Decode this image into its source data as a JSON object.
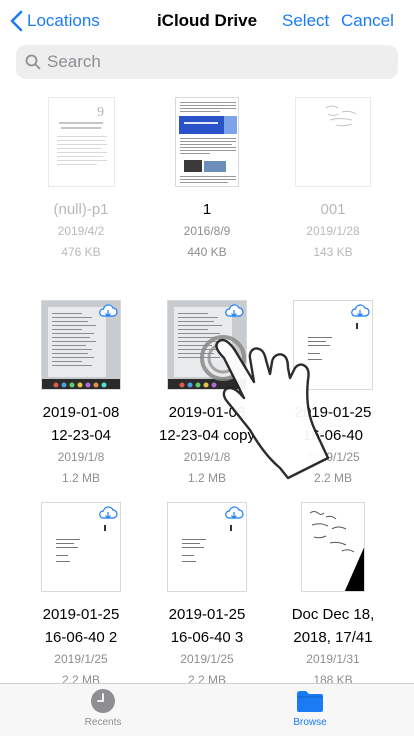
{
  "nav": {
    "back_label": "Locations",
    "title": "iCloud Drive",
    "select_label": "Select",
    "cancel_label": "Cancel"
  },
  "search": {
    "placeholder": "Search"
  },
  "files": [
    {
      "name": "(null)-p1",
      "date": "2019/4/2",
      "size": "476 KB",
      "dimmed": true
    },
    {
      "name": "1",
      "date": "2016/8/9",
      "size": "440 KB",
      "dimmed": false
    },
    {
      "name": "001",
      "date": "2019/1/28",
      "size": "143 KB",
      "dimmed": true
    },
    {
      "name": "2019-01-08\n12-23-04",
      "date": "2019/1/8",
      "size": "1.2 MB",
      "dimmed": false,
      "cloud": true
    },
    {
      "name": "2019-01-08\n12-23-04 copy",
      "date": "2019/1/8",
      "size": "1.2 MB",
      "dimmed": false,
      "cloud": true
    },
    {
      "name": "2019-01-25\n16-06-40",
      "date": "2019/1/25",
      "size": "2.2 MB",
      "dimmed": false,
      "cloud": true
    },
    {
      "name": "2019-01-25\n16-06-40 2",
      "date": "2019/1/25",
      "size": "2.2 MB",
      "dimmed": false,
      "cloud": true
    },
    {
      "name": "2019-01-25\n16-06-40 3",
      "date": "2019/1/25",
      "size": "2.2 MB",
      "dimmed": false,
      "cloud": true
    },
    {
      "name": "Doc Dec 18,\n2018, 17/41",
      "date": "2019/1/31",
      "size": "188 KB",
      "dimmed": false
    }
  ],
  "tabs": {
    "recents_label": "Recents",
    "browse_label": "Browse"
  },
  "colors": {
    "accent": "#1a7cf5",
    "secondary_text": "#8e8e93"
  }
}
